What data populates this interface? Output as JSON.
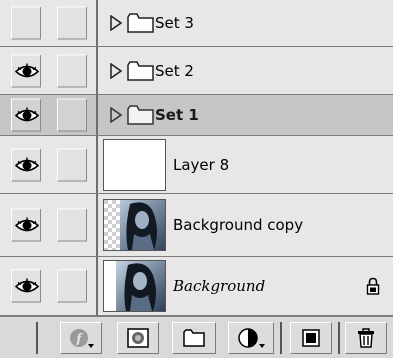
{
  "layers": [
    {
      "type": "group",
      "name": "Set 3",
      "visible": false,
      "selected": false
    },
    {
      "type": "group",
      "name": "Set 2",
      "visible": true,
      "selected": false
    },
    {
      "type": "group",
      "name": "Set 1",
      "visible": true,
      "selected": true
    },
    {
      "type": "layer",
      "name": "Layer 8",
      "visible": true,
      "selected": false
    },
    {
      "type": "layer",
      "name": "Background copy",
      "visible": true,
      "selected": false
    },
    {
      "type": "layer",
      "name": "Background",
      "visible": true,
      "selected": false,
      "locked": true
    }
  ],
  "icons": {
    "visibility": "eye-icon",
    "expand": "triangle-right-icon",
    "group": "folder-icon",
    "lock": "lock-icon"
  },
  "toolbar": {
    "buttons": [
      "layer-style-icon",
      "layer-mask-icon",
      "new-set-icon",
      "adjustment-layer-icon",
      "new-layer-icon",
      "trash-icon"
    ]
  },
  "colors": {
    "panel_bg": "#e7e7e7",
    "selected_bg": "#c6c6c6",
    "separator": "#7c7c7c"
  }
}
